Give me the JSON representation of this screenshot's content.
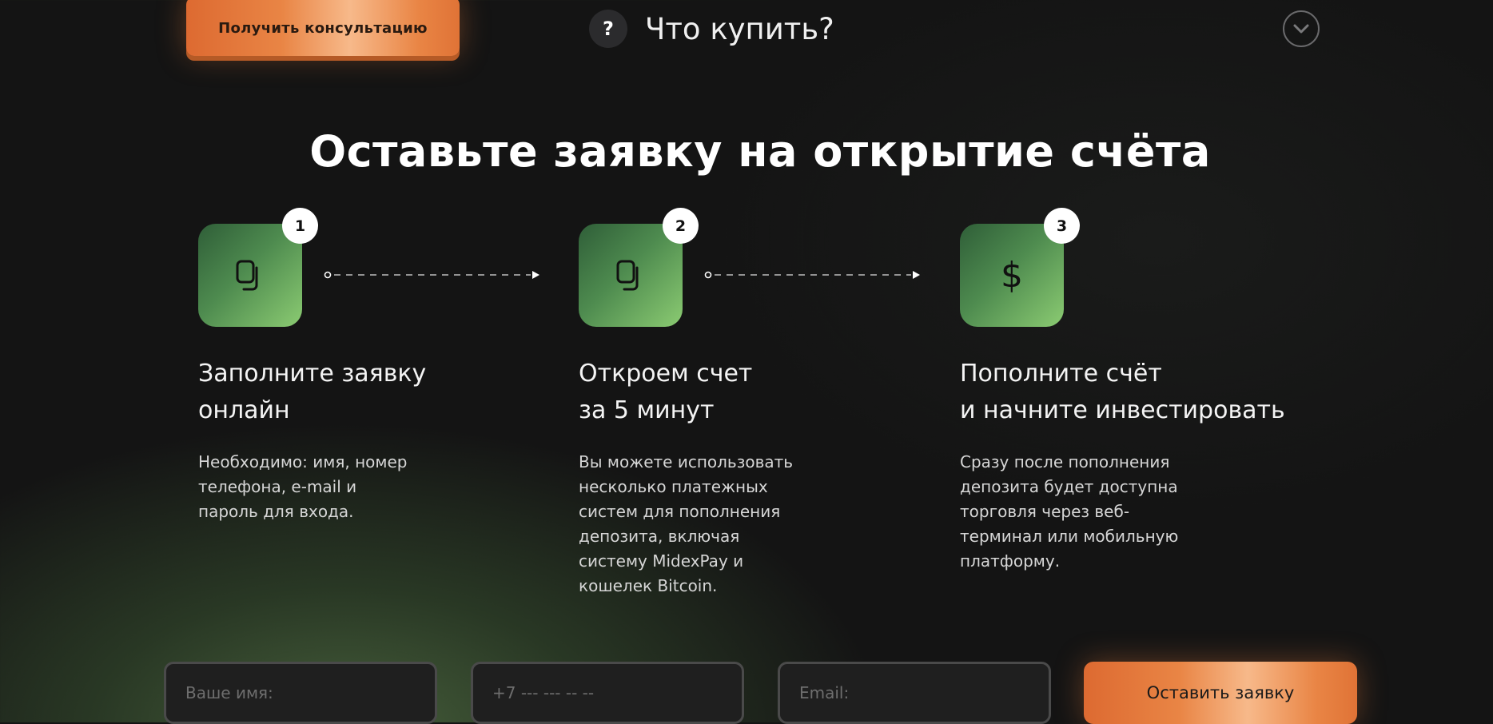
{
  "header": {
    "consult_button": "Получить консультацию",
    "faq_icon_glyph": "?",
    "faq_title": "Что купить?",
    "expand_icon": "chevron-down-icon"
  },
  "main": {
    "title": "Оставьте заявку на открытие счёта"
  },
  "steps": [
    {
      "number": "1",
      "icon": "documents-icon",
      "title_lines": [
        "Заполните заявку",
        "онлайн"
      ],
      "desc_lines": [
        "Необходимо: имя, номер",
        "телефона, e-mail и",
        "пароль для входа."
      ]
    },
    {
      "number": "2",
      "icon": "documents-icon",
      "title_lines": [
        "Откроем счет",
        "за 5 минут"
      ],
      "desc_lines": [
        "Вы можете использовать",
        "несколько платежных",
        "систем для пополнения",
        "депозита, включая",
        "систему MidexPay и",
        "кошелек Bitcoin."
      ]
    },
    {
      "number": "3",
      "icon": "dollar-icon",
      "icon_glyph": "$",
      "title_lines": [
        "Пополните счёт",
        "и начните инвестировать"
      ],
      "desc_lines": [
        "Сразу после пополнения",
        "депозита будет доступна",
        "торговля через веб-",
        "терминал или мобильную",
        "платформу."
      ]
    }
  ],
  "form": {
    "name_placeholder": "Ваше имя:",
    "phone_placeholder": "+7 --- --- -- --",
    "email_placeholder": "Email:",
    "submit_label": "Оставить заявку"
  },
  "colors": {
    "accent_orange": "#e98545",
    "accent_green": "#6faf5f",
    "background": "#141414"
  }
}
